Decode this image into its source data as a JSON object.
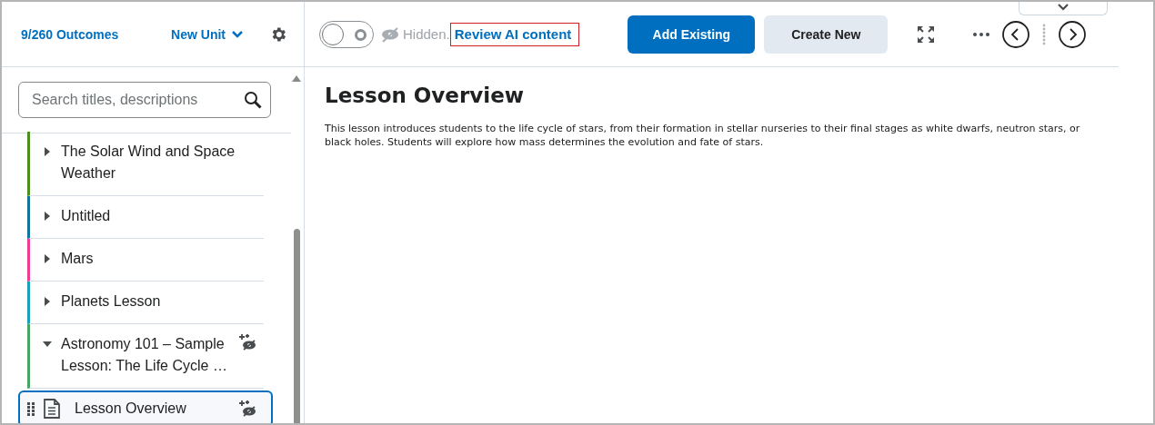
{
  "sidebar_header": {
    "outcomes": "9/260 Outcomes",
    "unit_menu": "New Unit"
  },
  "search": {
    "placeholder": "Search titles, descriptions"
  },
  "tree": [
    {
      "label": "The Solar Wind and Space Weather",
      "color": "#4a8f1e",
      "expanded": false,
      "ai": false
    },
    {
      "label": "Untitled",
      "color": "#11729a",
      "expanded": false,
      "ai": false
    },
    {
      "label": "Mars",
      "color": "#ee3b92",
      "expanded": false,
      "ai": false
    },
    {
      "label": "Planets Lesson",
      "color": "#16a1b8",
      "expanded": false,
      "ai": false
    },
    {
      "label": "Astronomy 101 – Sample Lesson: The Life Cycle …",
      "color": "#46a661",
      "expanded": true,
      "ai": true,
      "children": [
        {
          "label": "Lesson Overview",
          "selected": true,
          "ai": true
        }
      ]
    }
  ],
  "toolbar": {
    "visibility_on": false,
    "visibility_label": "Hidden.",
    "review_link": "Review AI content",
    "buttons": [
      "Add Existing",
      "Create New"
    ]
  },
  "content": {
    "title": "Lesson Overview",
    "body": "This lesson introduces students to the life cycle of stars, from their formation in stellar nurseries to their final stages as white dwarfs, neutron stars, or black holes. Students will explore how mass determines the evolution and fate of stars."
  }
}
